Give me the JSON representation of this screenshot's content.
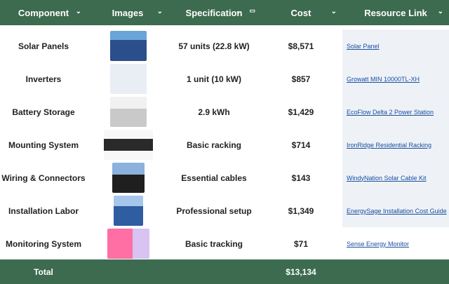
{
  "header": {
    "columns": [
      "Component",
      "Images",
      "Specification",
      "Cost",
      "Resource Link"
    ]
  },
  "rows": [
    {
      "component": "Solar Panels",
      "spec": "57 units (22.8 kW)",
      "cost": "$8,571",
      "link": "Solar Panel",
      "img": "solar-panel-photo"
    },
    {
      "component": "Inverters",
      "spec": "1 unit (10 kW)",
      "cost": "$857",
      "link": "Growatt MIN 10000TL-XH",
      "img": "inverter-photo"
    },
    {
      "component": "Battery Storage",
      "spec": "2.9 kWh",
      "cost": "$1,429",
      "link": "EcoFlow Delta 2 Power Station",
      "img": "battery-photo"
    },
    {
      "component": "Mounting System",
      "spec": "Basic racking",
      "cost": "$714",
      "link": "IronRidge Residential Racking",
      "img": "mounting-photo"
    },
    {
      "component": "Wiring & Connectors",
      "spec": "Essential cables",
      "cost": "$143",
      "link": "WindyNation Solar Cable Kit",
      "img": "wiring-photo"
    },
    {
      "component": "Installation Labor",
      "spec": "Professional setup",
      "cost": "$1,349",
      "link": "EnergySage Installation Cost Guide",
      "img": "installation-photo"
    },
    {
      "component": "Monitoring System",
      "spec": "Basic tracking",
      "cost": "$71",
      "link": "Sense Energy Monitor",
      "img": "monitor-photo"
    }
  ],
  "footer": {
    "label": "Total",
    "total": "$13,134"
  },
  "icons": {
    "sort": "chevron-down-icon",
    "filter": "filter-icon"
  },
  "colors": {
    "header_bg": "#3c6b4f",
    "link": "#1a4fa0"
  }
}
